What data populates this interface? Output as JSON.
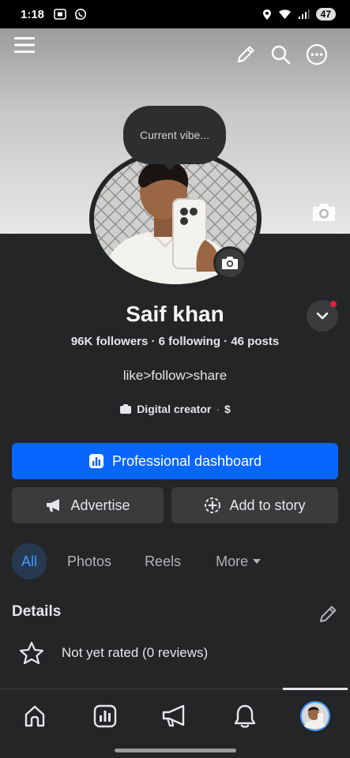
{
  "status_bar": {
    "time": "1:18",
    "battery": "47",
    "icons": [
      "screen-record-icon",
      "whatsapp-icon",
      "location-icon",
      "wifi-icon",
      "signal-icon"
    ]
  },
  "profile": {
    "vibe_prompt": "Current vibe...",
    "name": "Saif khan",
    "stats": "96K followers · 6 following · 46 posts",
    "bio": "like>follow>share",
    "category": "Digital creator",
    "category_sep": "·",
    "category_currency": "$"
  },
  "buttons": {
    "dashboard": "Professional dashboard",
    "advertise": "Advertise",
    "add_to_story": "Add to story"
  },
  "tabs": [
    {
      "label": "All",
      "active": true
    },
    {
      "label": "Photos",
      "active": false
    },
    {
      "label": "Reels",
      "active": false
    },
    {
      "label": "More",
      "active": false
    }
  ],
  "details": {
    "title": "Details",
    "rating": "Not yet rated (0 reviews)"
  },
  "colors": {
    "accent": "#0866ff",
    "background": "#242526",
    "active_tab_text": "#4599ff",
    "notification_dot": "#e41e3f"
  }
}
